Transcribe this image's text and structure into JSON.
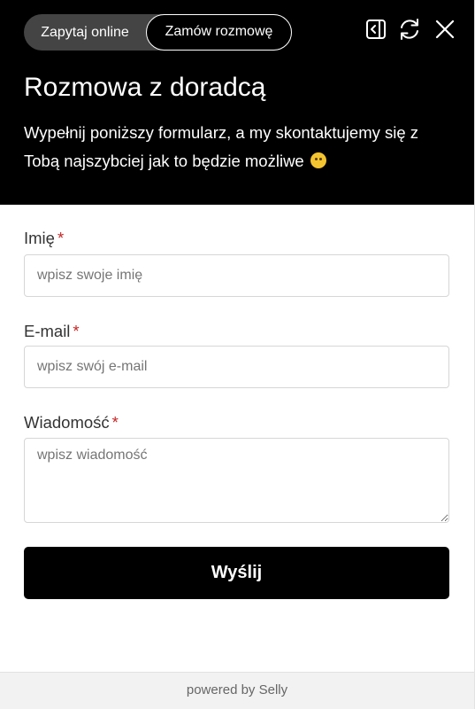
{
  "header": {
    "tabs": [
      {
        "label": "Zapytaj online",
        "active": false
      },
      {
        "label": "Zamów rozmowę",
        "active": true
      }
    ],
    "icons": [
      "collapse-panel-icon",
      "refresh-icon",
      "close-icon"
    ],
    "title": "Rozmowa z doradcą",
    "subtitle": "Wypełnij poniższy formularz, a my skontaktujemy się z Tobą najszybciej jak to będzie możliwe"
  },
  "form": {
    "name": {
      "label": "Imię",
      "required_mark": "*",
      "value": "",
      "placeholder": "wpisz swoje imię"
    },
    "email": {
      "label": "E-mail",
      "required_mark": "*",
      "value": "",
      "placeholder": "wpisz swój e-mail"
    },
    "message": {
      "label": "Wiadomość",
      "required_mark": "*",
      "value": "",
      "placeholder": "wpisz wiadomość"
    },
    "submit_label": "Wyślij"
  },
  "footer": {
    "text": "powered by Selly"
  },
  "colors": {
    "header_bg": "#000000",
    "tab_track": "#444444",
    "required": "#c62828",
    "button_bg": "#000000",
    "footer_bg": "#f2f2f2"
  }
}
